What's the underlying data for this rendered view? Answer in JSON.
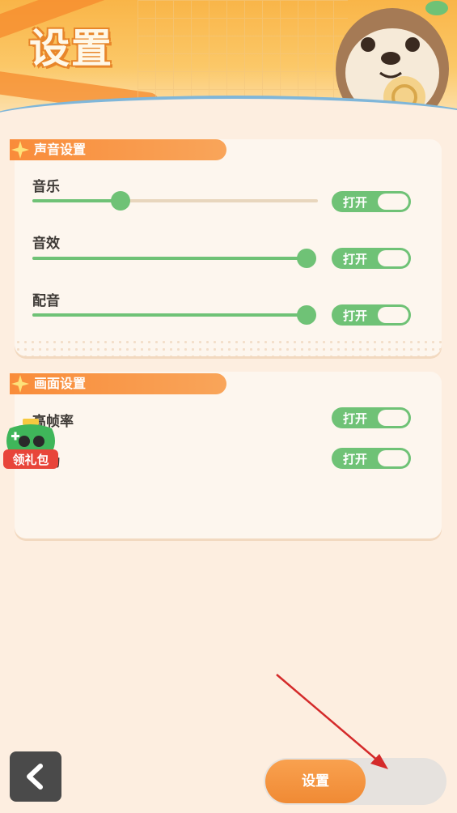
{
  "header": {
    "title": "设置"
  },
  "sound_panel": {
    "heading": "声音设置",
    "rows": [
      {
        "label": "音乐",
        "level": 0.31,
        "toggle": "打开"
      },
      {
        "label": "音效",
        "level": 1.0,
        "toggle": "打开"
      },
      {
        "label": "配音",
        "level": 1.0,
        "toggle": "打开"
      }
    ]
  },
  "display_panel": {
    "heading": "画面设置",
    "rows": [
      {
        "label": "高帧率",
        "toggle": "打开"
      },
      {
        "label": "震动",
        "toggle": "打开"
      }
    ]
  },
  "overlay": {
    "badge": "领礼包"
  },
  "bottom": {
    "settings_label": "设置",
    "back_icon": "chevron-left-icon"
  },
  "colors": {
    "accent": "#f98c3a",
    "green": "#6fc276",
    "background": "#fdeee0"
  }
}
